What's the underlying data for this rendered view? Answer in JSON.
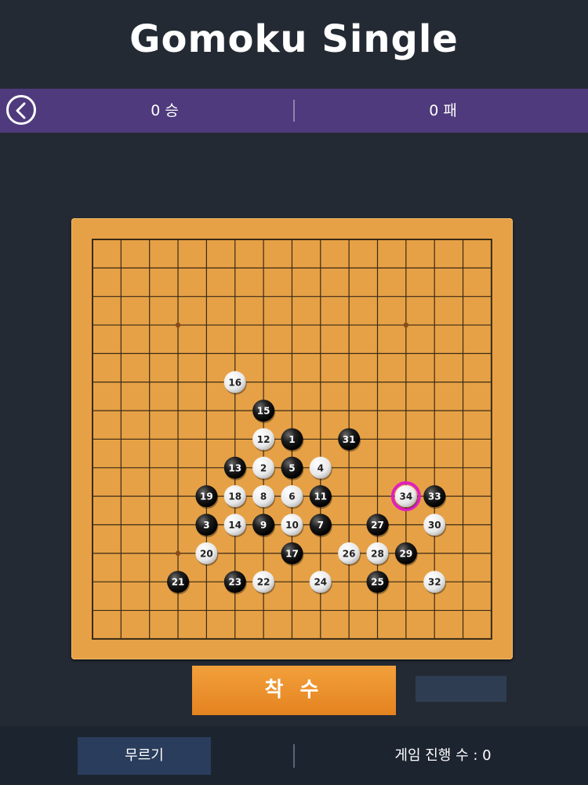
{
  "app": {
    "title": "Gomoku Single"
  },
  "score": {
    "wins": "0 승",
    "losses": "0 패"
  },
  "board": {
    "size": 15,
    "star_points": [
      [
        3,
        3
      ],
      [
        11,
        3
      ],
      [
        3,
        11
      ],
      [
        7,
        7
      ],
      [
        11,
        11
      ]
    ],
    "last_move": 34,
    "colors": {
      "board": "#e6a146",
      "highlight": "#e020c0"
    },
    "stones": [
      {
        "n": 1,
        "c": "b",
        "col": 7,
        "row": 7
      },
      {
        "n": 2,
        "c": "w",
        "col": 6,
        "row": 8
      },
      {
        "n": 3,
        "c": "b",
        "col": 4,
        "row": 10
      },
      {
        "n": 4,
        "c": "w",
        "col": 8,
        "row": 8
      },
      {
        "n": 5,
        "c": "b",
        "col": 7,
        "row": 8
      },
      {
        "n": 6,
        "c": "w",
        "col": 7,
        "row": 9
      },
      {
        "n": 7,
        "c": "b",
        "col": 8,
        "row": 10
      },
      {
        "n": 8,
        "c": "w",
        "col": 6,
        "row": 9
      },
      {
        "n": 9,
        "c": "b",
        "col": 6,
        "row": 10
      },
      {
        "n": 10,
        "c": "w",
        "col": 7,
        "row": 10
      },
      {
        "n": 11,
        "c": "b",
        "col": 8,
        "row": 9
      },
      {
        "n": 12,
        "c": "w",
        "col": 6,
        "row": 7
      },
      {
        "n": 13,
        "c": "b",
        "col": 5,
        "row": 8
      },
      {
        "n": 14,
        "c": "w",
        "col": 5,
        "row": 10
      },
      {
        "n": 15,
        "c": "b",
        "col": 6,
        "row": 6
      },
      {
        "n": 16,
        "c": "w",
        "col": 5,
        "row": 5
      },
      {
        "n": 17,
        "c": "b",
        "col": 7,
        "row": 11
      },
      {
        "n": 18,
        "c": "w",
        "col": 5,
        "row": 9
      },
      {
        "n": 19,
        "c": "b",
        "col": 4,
        "row": 9
      },
      {
        "n": 20,
        "c": "w",
        "col": 4,
        "row": 11
      },
      {
        "n": 21,
        "c": "b",
        "col": 3,
        "row": 12
      },
      {
        "n": 22,
        "c": "w",
        "col": 6,
        "row": 12
      },
      {
        "n": 23,
        "c": "b",
        "col": 5,
        "row": 12
      },
      {
        "n": 24,
        "c": "w",
        "col": 8,
        "row": 12
      },
      {
        "n": 25,
        "c": "b",
        "col": 10,
        "row": 12
      },
      {
        "n": 26,
        "c": "w",
        "col": 9,
        "row": 11
      },
      {
        "n": 27,
        "c": "b",
        "col": 10,
        "row": 10
      },
      {
        "n": 28,
        "c": "w",
        "col": 10,
        "row": 11
      },
      {
        "n": 29,
        "c": "b",
        "col": 11,
        "row": 11
      },
      {
        "n": 30,
        "c": "w",
        "col": 12,
        "row": 10
      },
      {
        "n": 31,
        "c": "b",
        "col": 9,
        "row": 7
      },
      {
        "n": 32,
        "c": "w",
        "col": 12,
        "row": 12
      },
      {
        "n": 33,
        "c": "b",
        "col": 12,
        "row": 9
      },
      {
        "n": 34,
        "c": "w",
        "col": 11,
        "row": 9
      }
    ]
  },
  "controls": {
    "place_label": "착 수",
    "undo_label": "무르기",
    "moves_label": "게임 진행 수 : 0"
  }
}
